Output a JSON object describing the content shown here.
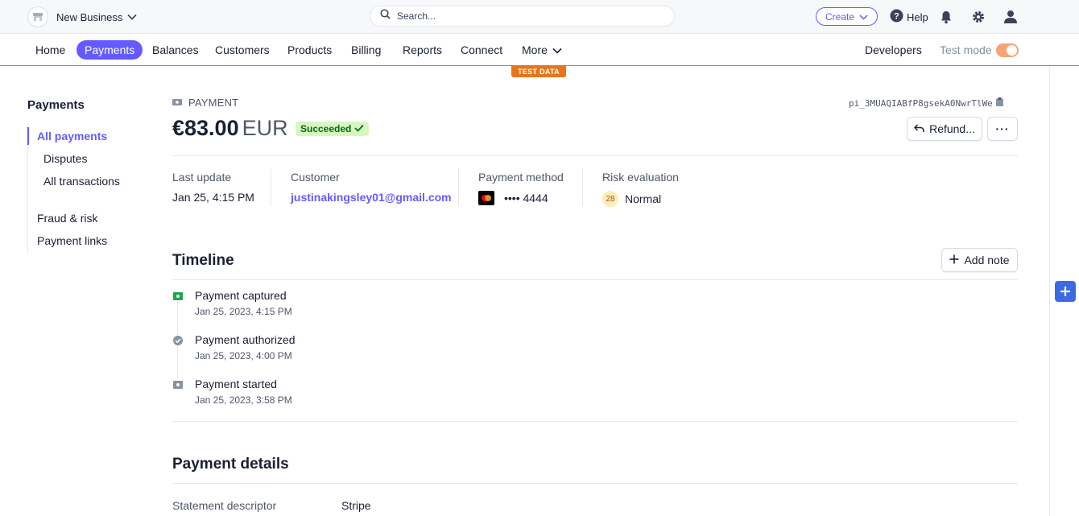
{
  "topbar": {
    "business_name": "New Business",
    "search_placeholder": "Search...",
    "create_label": "Create",
    "help_label": "Help",
    "icons": [
      "store-icon",
      "chevron-down-icon",
      "search-icon",
      "help-circle-icon",
      "bell-icon",
      "gear-icon",
      "user-icon"
    ]
  },
  "nav": {
    "items": [
      "Home",
      "Payments",
      "Balances",
      "Customers",
      "Products",
      "Billing",
      "Reports",
      "Connect",
      "More"
    ],
    "active": "Payments",
    "developers": "Developers",
    "test_mode_label": "Test mode",
    "test_mode_on": true,
    "test_data_badge": "TEST DATA"
  },
  "sidebar": {
    "title": "Payments",
    "items": [
      "All payments",
      "Disputes",
      "All transactions",
      "Fraud & risk",
      "Payment links"
    ],
    "active": "All payments"
  },
  "payment": {
    "kicker": "PAYMENT",
    "id": "pi_3MUAQIABfP8gsekA0NwrTlWe",
    "amount": "€83.00",
    "currency": "EUR",
    "status": "Succeeded",
    "refund_label": "Refund...",
    "more_label": "···"
  },
  "meta": {
    "last_update_label": "Last update",
    "last_update_value": "Jan 25, 4:15 PM",
    "customer_label": "Customer",
    "customer_value": "justinakingsley01@gmail.com",
    "method_label": "Payment method",
    "method_value": "•••• 4444",
    "risk_label": "Risk evaluation",
    "risk_score": "28",
    "risk_value": "Normal"
  },
  "timeline": {
    "title": "Timeline",
    "add_note_label": "Add note",
    "events": [
      {
        "title": "Payment captured",
        "time": "Jan 25, 2023, 4:15 PM"
      },
      {
        "title": "Payment authorized",
        "time": "Jan 25, 2023, 4:00 PM"
      },
      {
        "title": "Payment started",
        "time": "Jan 25, 2023, 3:58 PM"
      }
    ]
  },
  "details": {
    "title": "Payment details",
    "statement_descriptor_label": "Statement descriptor",
    "statement_descriptor_value": "Stripe"
  },
  "colors": {
    "accent": "#635bff",
    "test_mode": "#e8751a",
    "success_bg": "#d7f7c2",
    "success_text": "#05690d"
  }
}
